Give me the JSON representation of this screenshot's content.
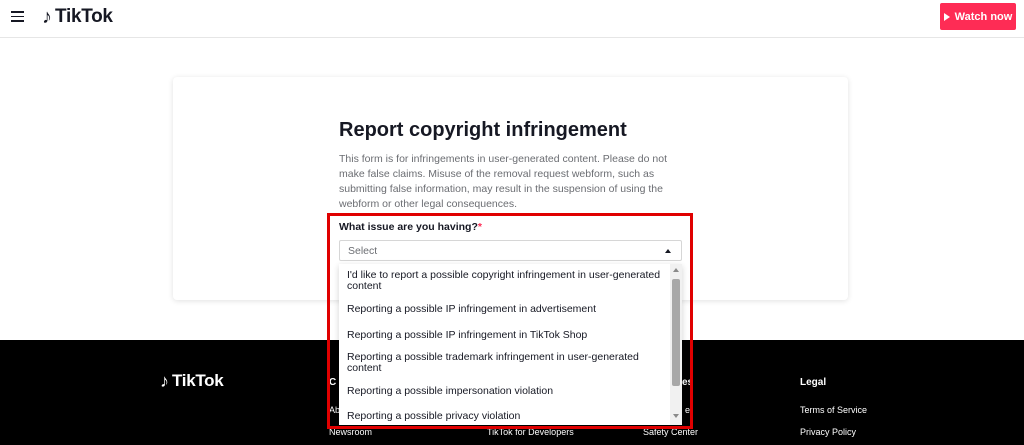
{
  "header": {
    "logo_text": "TikTok",
    "watch_label": "Watch now"
  },
  "page": {
    "title": "Report copyright infringement",
    "description": "This form is for infringements in user-generated content. Please do not make false claims. Misuse of the removal request webform, such as submitting false information, may result in the suspension of using the webform or other legal consequences."
  },
  "form": {
    "issue_label": "What issue are you having?",
    "required_mark": "*",
    "select_placeholder": "Select",
    "options": [
      "I'd like to report a possible copyright infringement in user-generated content",
      "Reporting a possible IP infringement in advertisement",
      "Reporting a possible IP infringement in TikTok Shop",
      "Reporting a possible trademark infringement in user-generated content",
      "Reporting a possible impersonation violation",
      "Reporting a possible privacy violation"
    ]
  },
  "footer": {
    "logo_text": "TikTok",
    "col1_head_fragment": "C",
    "col1_item1_fragment": "Ab",
    "col1_item2": "Newsroom",
    "col2_item": "TikTok for Developers",
    "col3_head_fragment": "es",
    "col3_item1_fragment": "er",
    "col3_item2": "Safety Center",
    "legal_head": "Legal",
    "legal_items": [
      "Terms of Service",
      "Privacy Policy"
    ]
  },
  "colors": {
    "brand": "#fe2c55",
    "highlight": "#e00000"
  }
}
